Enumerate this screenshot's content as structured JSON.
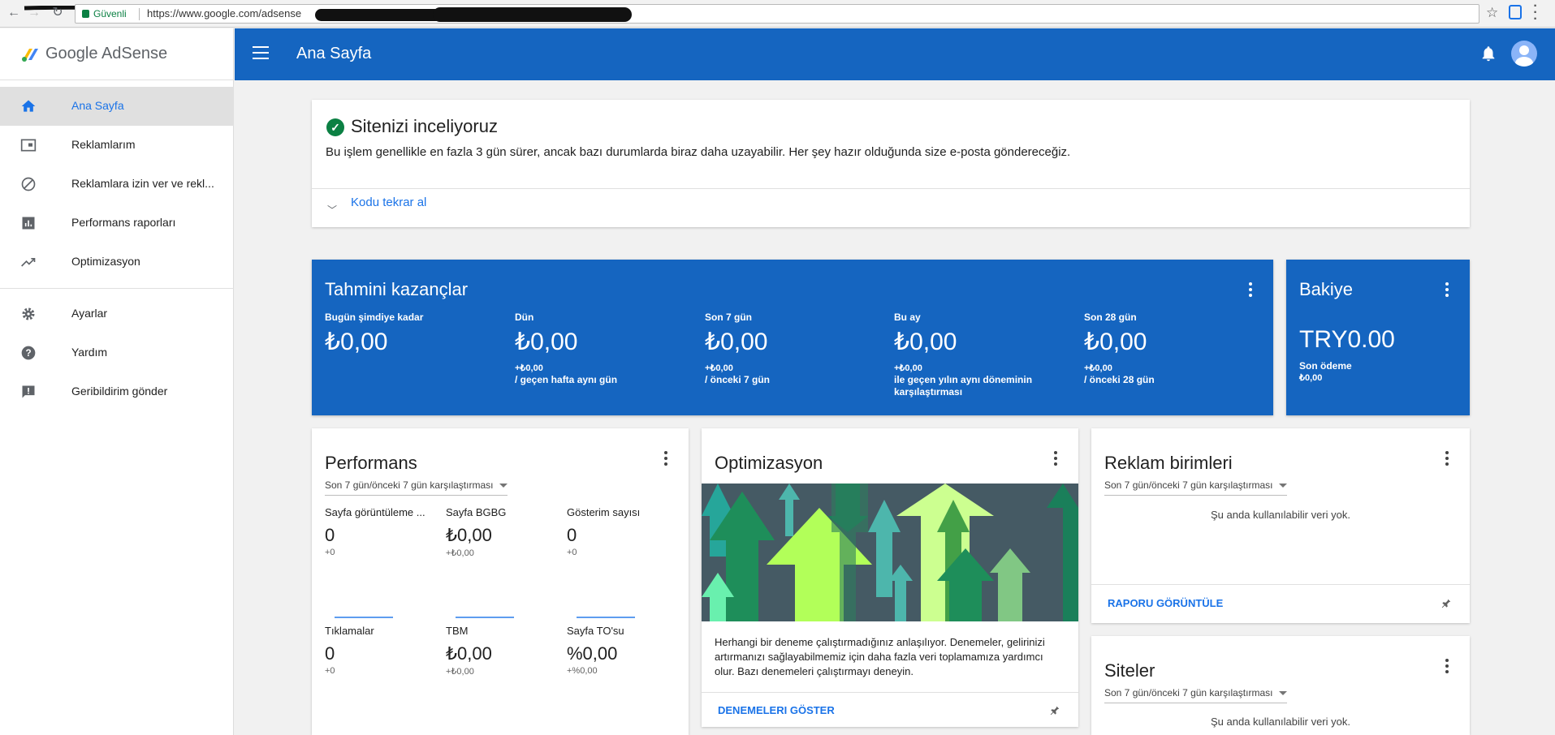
{
  "browser": {
    "secure_label": "Güvenli",
    "url": "https://www.google.com/adsense"
  },
  "sidebar": {
    "logo_text": "Google AdSense",
    "items": [
      {
        "label": "Ana Sayfa",
        "icon": "home-icon"
      },
      {
        "label": "Reklamlarım",
        "icon": "ads-icon"
      },
      {
        "label": "Reklamlara izin ver ve rekl...",
        "icon": "block-icon"
      },
      {
        "label": "Performans raporları",
        "icon": "bar-chart-icon"
      },
      {
        "label": "Optimizasyon",
        "icon": "trending-up-icon"
      },
      {
        "label": "Ayarlar",
        "icon": "gear-icon"
      },
      {
        "label": "Yardım",
        "icon": "help-icon"
      },
      {
        "label": "Geribildirim gönder",
        "icon": "feedback-icon"
      }
    ]
  },
  "header": {
    "title": "Ana Sayfa"
  },
  "review": {
    "title": "Sitenizi inceliyoruz",
    "description": "Bu işlem genellikle en fazla 3 gün sürer, ancak bazı durumlarda biraz daha uzayabilir. Her şey hazır olduğunda size e-posta göndereceğiz.",
    "link": "Kodu tekrar al"
  },
  "earnings": {
    "title": "Tahmini kazançlar",
    "metrics": [
      {
        "label": "Bugün şimdiye kadar",
        "value": "₺0,00",
        "change": "",
        "compare": ""
      },
      {
        "label": "Dün",
        "value": "₺0,00",
        "change": "+₺0,00",
        "compare": "/ geçen hafta aynı gün"
      },
      {
        "label": "Son 7 gün",
        "value": "₺0,00",
        "change": "+₺0,00",
        "compare": "/ önceki 7 gün"
      },
      {
        "label": "Bu ay",
        "value": "₺0,00",
        "change": "+₺0,00",
        "compare": "ile geçen yılın aynı döneminin karşılaştırması"
      },
      {
        "label": "Son 28 gün",
        "value": "₺0,00",
        "change": "+₺0,00",
        "compare": "/ önceki 28 gün"
      }
    ]
  },
  "balance": {
    "title": "Bakiye",
    "value": "TRY0.00",
    "sub_label": "Son ödeme",
    "sub_value": "₺0,00"
  },
  "performance": {
    "title": "Performans",
    "range": "Son 7 gün/önceki 7 gün karşılaştırması",
    "metrics": [
      {
        "label": "Sayfa görüntüleme ...",
        "value": "0",
        "change": "+0"
      },
      {
        "label": "Sayfa BGBG",
        "value": "₺0,00",
        "change": "+₺0,00"
      },
      {
        "label": "Gösterim sayısı",
        "value": "0",
        "change": "+0"
      },
      {
        "label": "Tıklamalar",
        "value": "0",
        "change": "+0"
      },
      {
        "label": "TBM",
        "value": "₺0,00",
        "change": "+₺0,00"
      },
      {
        "label": "Sayfa TO'su",
        "value": "%0,00",
        "change": "+%0,00"
      }
    ]
  },
  "optimization": {
    "title": "Optimizasyon",
    "text": "Herhangi bir deneme çalıştırmadığınız anlaşılıyor. Denemeler, gelirinizi artırmanızı sağlayabilmemiz için daha fazla veri toplamamıza yardımcı olur. Bazı denemeleri çalıştırmayı deneyin.",
    "action": "DENEMELERI GÖSTER"
  },
  "ad_units": {
    "title": "Reklam birimleri",
    "range": "Son 7 gün/önceki 7 gün karşılaştırması",
    "empty": "Şu anda kullanılabilir veri yok.",
    "action": "RAPORU GÖRÜNTÜLE"
  },
  "sites": {
    "title": "Siteler",
    "range": "Son 7 gün/önceki 7 gün karşılaştırması",
    "empty": "Şu anda kullanılabilir veri yok."
  },
  "colors": {
    "brand_blue": "#1565c0",
    "link_blue": "#1a73e8",
    "success_green": "#0b8043"
  }
}
